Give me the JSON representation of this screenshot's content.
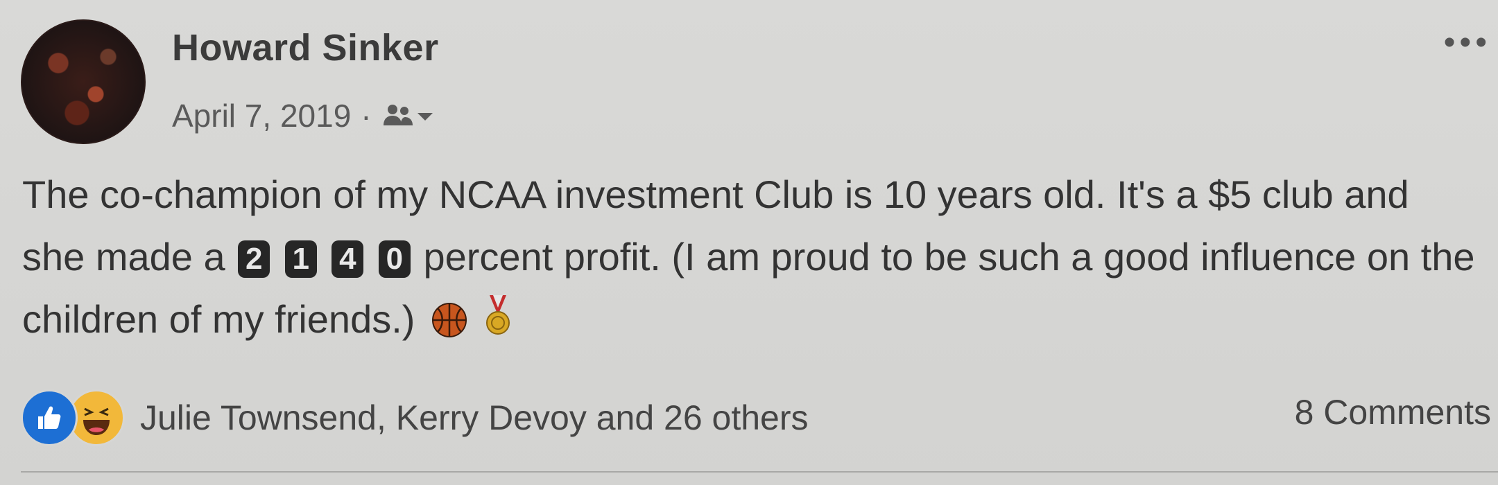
{
  "post": {
    "author": "Howard Sinker",
    "date": "April 7, 2019",
    "separator": "·",
    "audience_icon": "friends-icon",
    "text_before": "The co-champion of my NCAA investment Club is 10 years old. It's a $5 club and she made a ",
    "digits": [
      "2",
      "1",
      "4",
      "0"
    ],
    "text_after": " percent profit. (I am proud to be such a good influence on the children of my friends.)",
    "emojis": [
      "basketball-icon",
      "medal-icon"
    ]
  },
  "reactions": {
    "icons": [
      "like-icon",
      "haha-icon"
    ],
    "names": "Julie Townsend, Kerry Devoy and 26 others"
  },
  "comments": {
    "count_label": "8 Comments"
  },
  "colors": {
    "like_blue": "#1d6fd4",
    "haha_yellow": "#f2b83a",
    "background": "#d6d6d4"
  }
}
